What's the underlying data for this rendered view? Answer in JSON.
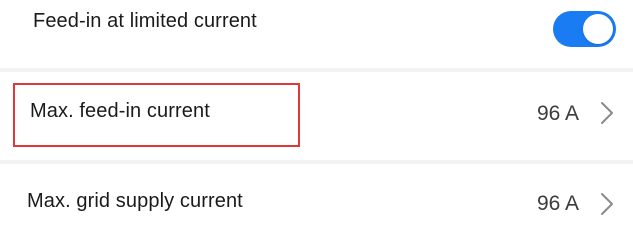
{
  "settings": {
    "feed_in_limited": {
      "label": "Feed-in at limited current",
      "toggle_on": true,
      "accent_color": "#1a7cf2"
    },
    "max_feed_in_current": {
      "label": "Max. feed-in current",
      "value": "96 A",
      "icon": "chevron-right-icon"
    },
    "max_grid_supply_current": {
      "label": "Max. grid supply current",
      "value": "96 A",
      "icon": "chevron-right-icon"
    }
  },
  "highlight": {
    "target": "max_feed_in_current",
    "color": "#e0373b"
  }
}
